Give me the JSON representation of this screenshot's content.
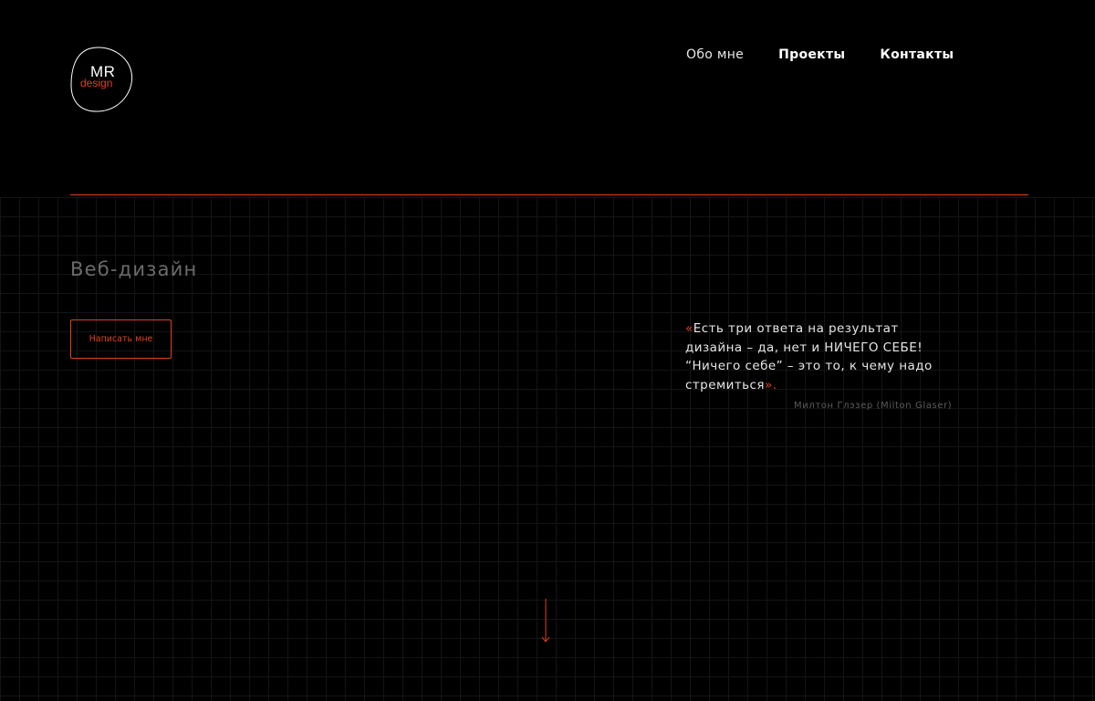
{
  "logo": {
    "primary": "MR",
    "secondary": "design"
  },
  "nav": {
    "items": [
      {
        "label": "Обо мне"
      },
      {
        "label": "Проекты"
      },
      {
        "label": "Контакты"
      }
    ]
  },
  "hero": {
    "title": "Веб-дизайн",
    "cta_label": "Написать мне"
  },
  "quote": {
    "open_mark": "«",
    "text": "Есть три ответа на результат дизайна – да, нет и НИЧЕГО СЕБЕ! “Ничего себе” – это то, к чему надо стремиться",
    "close_mark": "».",
    "author": "Милтон Глэзер (Milton Glaser)"
  },
  "icons": {
    "scroll": "arrow-down-icon"
  },
  "colors": {
    "background": "#000000",
    "accent": "#e0421c",
    "text": "#ffffff",
    "muted": "#6b6b6b"
  }
}
